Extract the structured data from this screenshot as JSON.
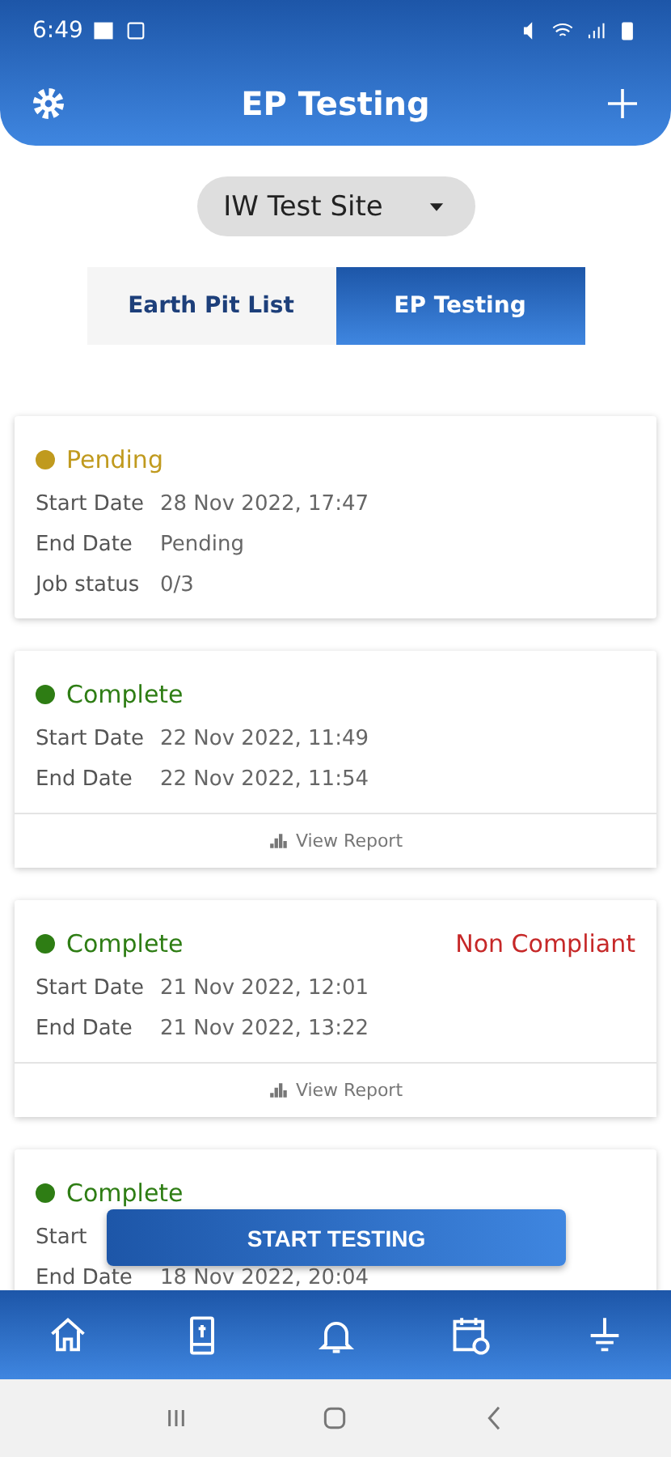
{
  "status_bar": {
    "time": "6:49"
  },
  "header": {
    "title": "EP Testing"
  },
  "site_selector": {
    "value": "IW Test Site"
  },
  "tabs": [
    {
      "label": "Earth Pit List",
      "selected": false
    },
    {
      "label": "EP Testing",
      "selected": true
    }
  ],
  "jobs": [
    {
      "status": "Pending",
      "color": "#c09a1e",
      "rows": [
        {
          "label": "Start Date",
          "value": "28 Nov 2022, 17:47"
        },
        {
          "label": "End Date",
          "value": "Pending"
        },
        {
          "label": "Job status",
          "value": "0/3"
        }
      ]
    },
    {
      "status": "Complete",
      "color": "#2e7d14",
      "rows": [
        {
          "label": "Start Date",
          "value": "22 Nov 2022, 11:49"
        },
        {
          "label": "End Date",
          "value": "22 Nov 2022, 11:54"
        }
      ],
      "report_link": "View Report"
    },
    {
      "status": "Complete",
      "color": "#2e7d14",
      "compliance": "Non Compliant",
      "rows": [
        {
          "label": "Start Date",
          "value": "21 Nov 2022, 12:01"
        },
        {
          "label": "End Date",
          "value": "21 Nov 2022, 13:22"
        }
      ],
      "report_link": "View Report"
    },
    {
      "status": "Complete",
      "color": "#2e7d14",
      "rows": [
        {
          "label": "Start"
        },
        {
          "label": "End Date",
          "value": "18 Nov 2022, 20:04"
        }
      ]
    }
  ],
  "start_button": "START TESTING"
}
